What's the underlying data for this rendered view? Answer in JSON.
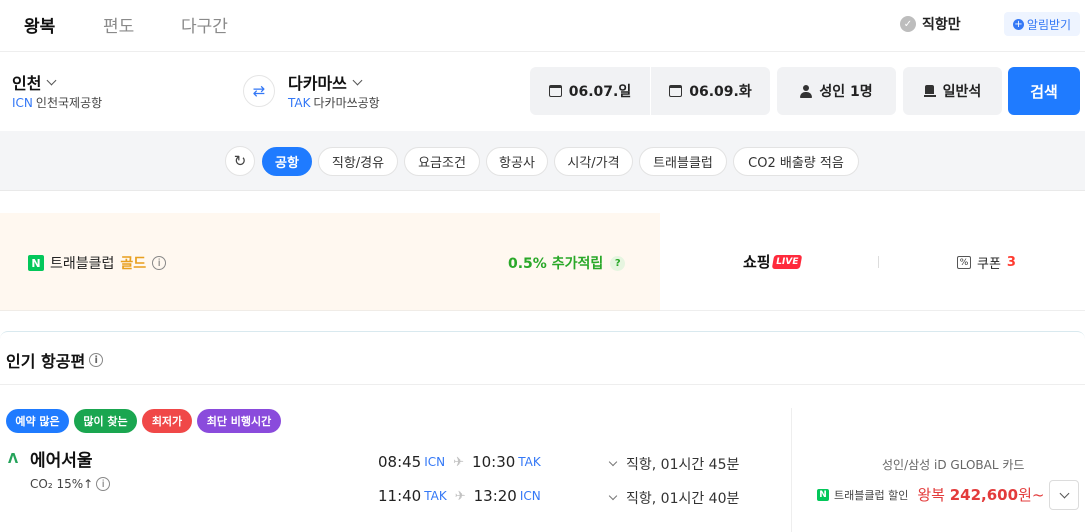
{
  "trip_tabs": [
    "왕복",
    "편도",
    "다구간"
  ],
  "nonstop_label": "직항만",
  "alert_label": "알림받기",
  "origin": {
    "city": "인천",
    "code": "ICN",
    "airport": "인천국제공항"
  },
  "destination": {
    "city": "다카마쓰",
    "code": "TAK",
    "airport": "다카마쓰공항"
  },
  "dates": {
    "depart": "06.07.일",
    "return": "06.09.화"
  },
  "passengers": "성인 1명",
  "seat_class": "일반석",
  "search_label": "검색",
  "filters": [
    "공항",
    "직항/경유",
    "요금조건",
    "항공사",
    "시각/가격",
    "트래블클럽",
    "CO2 배출량 적음"
  ],
  "promo": {
    "npay_badge": "N",
    "travelclub_label": "트래블클럽",
    "tier": "골드",
    "points_text": "0.5% 추가적립",
    "shopping_label": "쇼핑",
    "live_badge": "LIVE",
    "coupon_label": "쿠폰",
    "coupon_count": "3"
  },
  "popular": {
    "title": "인기 항공편",
    "tags": [
      {
        "label": "예약 많은",
        "color": "#1f7bff"
      },
      {
        "label": "많이 찾는",
        "color": "#1aa650"
      },
      {
        "label": "최저가",
        "color": "#f04848"
      },
      {
        "label": "최단 비행시간",
        "color": "#8a4bdc"
      }
    ],
    "flight": {
      "airline": "에어서울",
      "co2": "CO₂ 15%↑",
      "legs": [
        {
          "dep_time": "08:45",
          "dep_code": "ICN",
          "arr_time": "10:30",
          "arr_code": "TAK",
          "info": "직항, 01시간 45분"
        },
        {
          "dep_time": "11:40",
          "dep_code": "TAK",
          "arr_time": "13:20",
          "arr_code": "ICN",
          "info": "직항, 01시간 40분"
        }
      ],
      "card_text": "성인/삼성 iD GLOBAL 카드",
      "discount_label": "트래블클럽 할인",
      "price_prefix": "왕복",
      "price": "242,600",
      "price_suffix": "원~"
    }
  },
  "colors": {
    "accent": "#1f7bff",
    "green": "#03c75a",
    "gold": "#e8a020",
    "price_red": "#e33b3b"
  }
}
